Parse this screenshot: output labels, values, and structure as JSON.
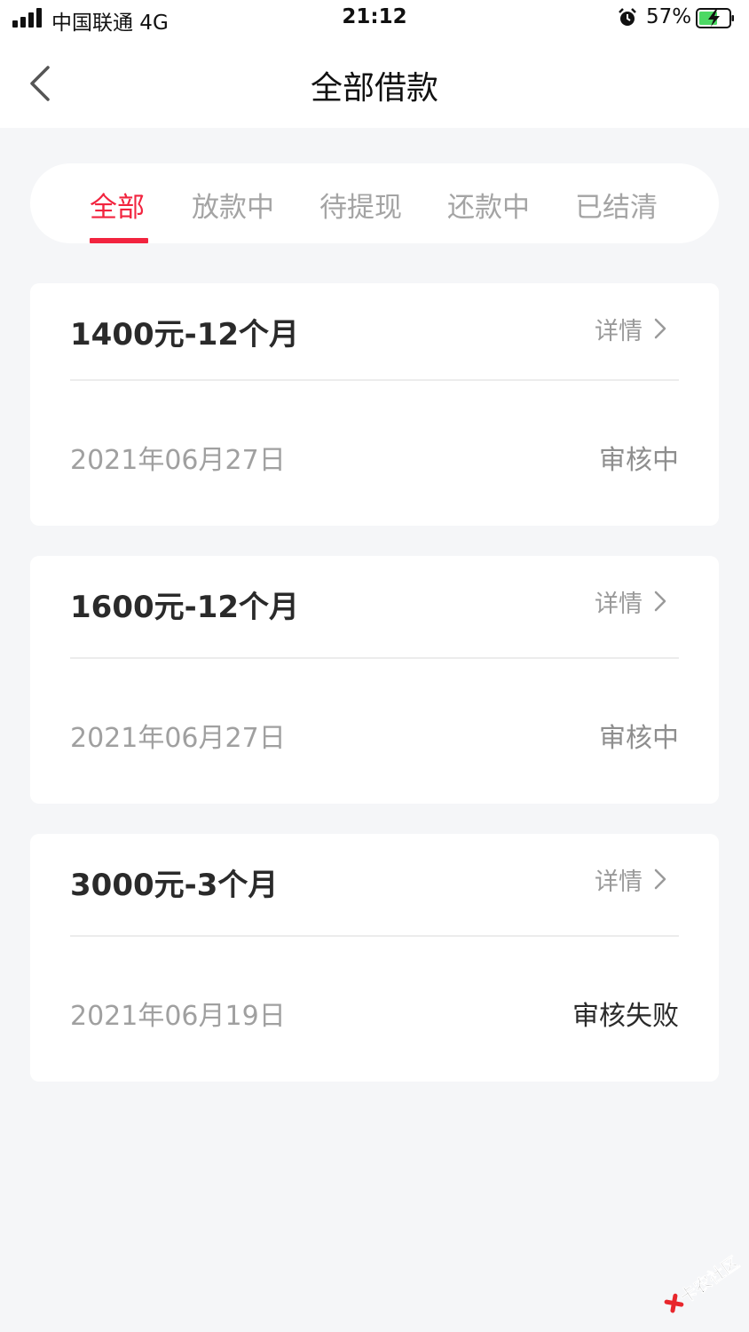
{
  "status_bar": {
    "carrier": "中国联通  4G",
    "time": "21:12",
    "battery": "57%"
  },
  "nav": {
    "title": "全部借款",
    "back_icon": "chevron-left-icon"
  },
  "tabs": [
    {
      "label": "全部",
      "active": true
    },
    {
      "label": "放款中",
      "active": false
    },
    {
      "label": "待提现",
      "active": false
    },
    {
      "label": "还款中",
      "active": false
    },
    {
      "label": "已结清",
      "active": false
    }
  ],
  "loans": [
    {
      "title": "1400元-12个月",
      "detail": "详情",
      "date": "2021年06月27日",
      "status": "审核中"
    },
    {
      "title": "1600元-12个月",
      "detail": "详情",
      "date": "2021年06月27日",
      "status": "审核中"
    },
    {
      "title": "3000元-3个月",
      "detail": "详情",
      "date": "2021年06月19日",
      "status": "审核失败"
    }
  ],
  "watermark": "卡农社区",
  "colors": {
    "accent": "#f2243f",
    "background": "#f5f6f8",
    "muted_text": "#a0a0a0"
  }
}
